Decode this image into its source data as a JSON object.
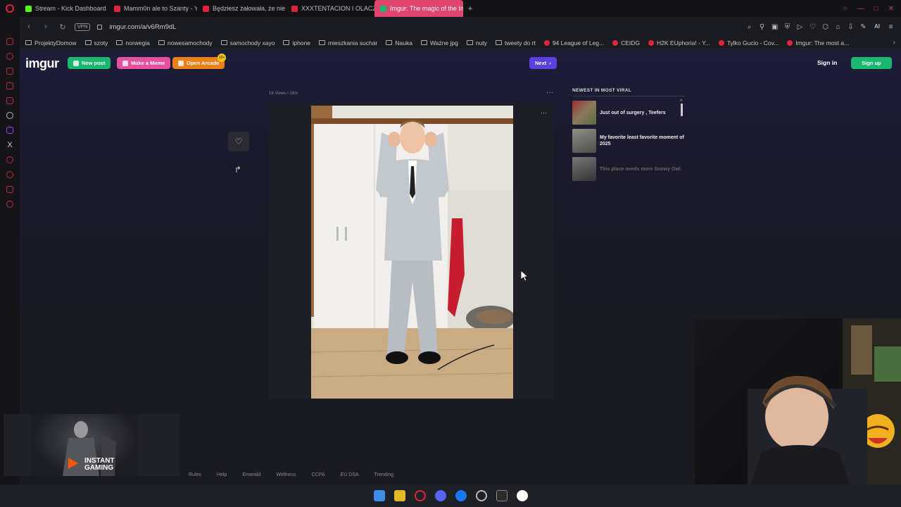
{
  "browser": {
    "tabs": [
      {
        "label": "Stream - Kick Dashboard",
        "color": "#53fc18"
      },
      {
        "label": "Mamm0n ale to Szanty - Y",
        "color": "#e0233b"
      },
      {
        "label": "Będziesz żałowała, że nie",
        "color": "#e0233b"
      },
      {
        "label": "XXXTENTACION I OLACZK",
        "color": "#e0233b"
      },
      {
        "label": "Imgur: The magic of the In",
        "color": "#1bb76e"
      }
    ],
    "new_tab": "+",
    "url": "imgur.com/a/v6Rm9dL",
    "vpn": "VPN",
    "ai_label": "AI"
  },
  "bookmarks": [
    {
      "label": "ProjektyDomow",
      "type": "folder"
    },
    {
      "label": "szoty",
      "type": "folder"
    },
    {
      "label": "norwegia",
      "type": "folder"
    },
    {
      "label": "nowesamochody",
      "type": "folder"
    },
    {
      "label": "samochody xayo",
      "type": "folder"
    },
    {
      "label": "iphone",
      "type": "folder"
    },
    {
      "label": "mieszkania suchar",
      "type": "folder"
    },
    {
      "label": "Nauka",
      "type": "folder"
    },
    {
      "label": "Ważne jpg",
      "type": "folder"
    },
    {
      "label": "nuty",
      "type": "folder"
    },
    {
      "label": "tweety do rt",
      "type": "folder"
    },
    {
      "label": "94 League of Leg...",
      "type": "site"
    },
    {
      "label": "CEIDG",
      "type": "site"
    },
    {
      "label": "H2K EUphoria! - Y...",
      "type": "site"
    },
    {
      "label": "Tylko Gucio - Cov...",
      "type": "site"
    },
    {
      "label": "Imgur: The most a...",
      "type": "site"
    }
  ],
  "imgur": {
    "logo": "imgur",
    "new_post": "New post",
    "make_meme": "Make a Meme",
    "open_arcade": "Open Arcade",
    "arcade_badge": "12+",
    "next": "Next",
    "sign_in": "Sign in",
    "sign_up": "Sign up",
    "post_meta": "16 Views • 16m",
    "viral_title": "NEWEST IN MOST VIRAL",
    "viral_items": [
      {
        "title": "Just out of surgery , Teefers",
        "thumb_color": "#8a7a5e"
      },
      {
        "title": "My favorite least favorite moment of 2025",
        "thumb_color": "#6a6a66"
      },
      {
        "title": "This place needs more Snowy Owl.",
        "thumb_color": "#555558"
      }
    ],
    "footer": [
      "Rules",
      "Help",
      "Emerald",
      "Wellness",
      "CCPA",
      "EU DSA",
      "Trending"
    ]
  },
  "ad": {
    "line1": "INSTANT",
    "line2": "GAMING"
  },
  "icons": {
    "favorite": "heart-icon",
    "share": "share-arrow-icon",
    "more": "ellipsis-icon"
  }
}
